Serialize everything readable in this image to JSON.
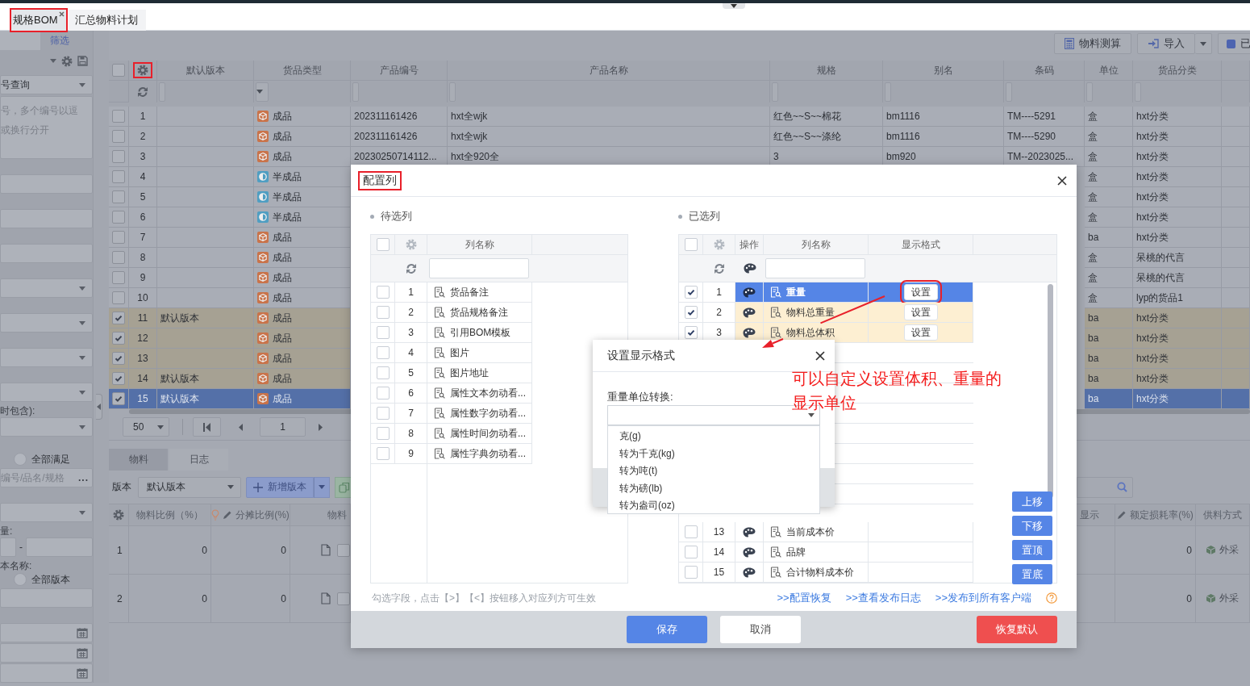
{
  "tabs": [
    {
      "label": "规格BOM",
      "selected": true,
      "closable": true,
      "highlighted": true
    },
    {
      "label": "汇总物料计划",
      "selected": false,
      "closable": false,
      "highlighted": false
    }
  ],
  "filter_panel": {
    "title": "筛选",
    "fields": [
      {
        "kind": "select",
        "value": "号查询"
      },
      {
        "kind": "textarea",
        "placeholder": "号，多个编号以逗或换行分开"
      },
      {
        "kind": "input"
      },
      {
        "kind": "input"
      },
      {
        "kind": "input"
      },
      {
        "kind": "select"
      },
      {
        "kind": "select"
      },
      {
        "kind": "select"
      },
      {
        "kind": "select"
      },
      {
        "kind": "select",
        "label": "时包含):"
      },
      {
        "kind": "radio",
        "option": "全部满足",
        "selected": false
      },
      {
        "kind": "picker",
        "placeholder": "编号/品名/规格",
        "button": "..."
      },
      {
        "kind": "select"
      },
      {
        "kind": "range",
        "label": "量:",
        "separator": "-"
      },
      {
        "kind": "radio",
        "label": "本名称:",
        "option": "全部版本",
        "selected": false
      },
      {
        "kind": "input"
      },
      {
        "kind": "date"
      },
      {
        "kind": "date"
      },
      {
        "kind": "date"
      }
    ]
  },
  "toolbar": [
    {
      "kind": "calc",
      "label": "物料测算",
      "dropdown": false
    },
    {
      "kind": "import",
      "label": "导入",
      "dropdown": true
    },
    {
      "kind": "status",
      "label": "已",
      "dropdown": false
    }
  ],
  "grid": {
    "settings_highlighted": true,
    "all_checked": false,
    "columns": [
      {
        "label": "默认版本",
        "kind": "input"
      },
      {
        "label": "货品类型",
        "kind": "select"
      },
      {
        "label": "产品编号",
        "kind": "input"
      },
      {
        "label": "产品名称",
        "kind": "input"
      },
      {
        "label": "规格",
        "kind": "input"
      },
      {
        "label": "别名",
        "kind": "input"
      },
      {
        "label": "条码",
        "kind": "input"
      },
      {
        "label": "单位",
        "kind": "input"
      },
      {
        "label": "货品分类",
        "kind": "input"
      }
    ],
    "rows": [
      {
        "number": "1",
        "checked": false,
        "selected": false,
        "type": {
          "kind": "finished",
          "label": "成品"
        },
        "code": "202311161426",
        "name": "hxt全wjk",
        "spec": "红色~~S~~棉花",
        "alias": "bm1116",
        "barcode": "TM----5291",
        "unit": "盒",
        "category": "hxt分类"
      },
      {
        "number": "2",
        "checked": false,
        "selected": false,
        "type": {
          "kind": "finished",
          "label": "成品"
        },
        "code": "202311161426",
        "name": "hxt全wjk",
        "spec": "红色~~S~~涤纶",
        "alias": "bm1116",
        "barcode": "TM----5290",
        "unit": "盒",
        "category": "hxt分类"
      },
      {
        "number": "3",
        "checked": false,
        "selected": false,
        "type": {
          "kind": "finished",
          "label": "成品"
        },
        "code": "20230250714112...",
        "name": "hxt全920全",
        "spec": "3",
        "alias": "bm920",
        "barcode": "TM--2023025...",
        "unit": "盒",
        "category": "hxt分类"
      },
      {
        "number": "4",
        "checked": false,
        "selected": false,
        "type": {
          "kind": "semi",
          "label": "半成品"
        },
        "unit": "盒",
        "category": "hxt分类"
      },
      {
        "number": "5",
        "checked": false,
        "selected": false,
        "type": {
          "kind": "semi",
          "label": "半成品"
        },
        "unit": "盒",
        "category": "hxt分类"
      },
      {
        "number": "6",
        "checked": false,
        "selected": false,
        "type": {
          "kind": "semi",
          "label": "半成品"
        },
        "unit": "盒",
        "category": "hxt分类"
      },
      {
        "number": "7",
        "checked": false,
        "selected": false,
        "type": {
          "kind": "finished",
          "label": "成品"
        },
        "unit": "ba",
        "category": "hxt分类"
      },
      {
        "number": "8",
        "checked": false,
        "selected": false,
        "type": {
          "kind": "finished",
          "label": "成品"
        },
        "unit": "盒",
        "category": "呆桃的代言"
      },
      {
        "number": "9",
        "checked": false,
        "selected": false,
        "type": {
          "kind": "finished",
          "label": "成品"
        },
        "unit": "盒",
        "category": "呆桃的代言"
      },
      {
        "number": "10",
        "checked": false,
        "selected": false,
        "type": {
          "kind": "finished",
          "label": "成品"
        },
        "unit": "盒",
        "category": "lyp的货品1"
      },
      {
        "number": "11",
        "checked": true,
        "selected": false,
        "version": "默认版本",
        "type": {
          "kind": "finished",
          "label": "成品"
        },
        "unit": "ba",
        "category": "hxt分类"
      },
      {
        "number": "12",
        "checked": true,
        "selected": false,
        "type": {
          "kind": "finished",
          "label": "成品"
        },
        "unit": "ba",
        "category": "hxt分类"
      },
      {
        "number": "13",
        "checked": true,
        "selected": false,
        "type": {
          "kind": "finished",
          "label": "成品"
        },
        "unit": "ba",
        "category": "hxt分类"
      },
      {
        "number": "14",
        "checked": true,
        "selected": false,
        "version": "默认版本",
        "type": {
          "kind": "finished",
          "label": "成品"
        },
        "unit": "ba",
        "category": "hxt分类"
      },
      {
        "number": "15",
        "checked": true,
        "selected": true,
        "version": "默认版本",
        "type": {
          "kind": "finished",
          "label": "成品"
        },
        "unit": "ba",
        "category": "hxt分类"
      }
    ]
  },
  "pager": {
    "page_size": "50",
    "page": "1"
  },
  "bottom": {
    "tabs": [
      {
        "label": "物料",
        "selected": true
      },
      {
        "label": "日志",
        "selected": false
      }
    ],
    "version_label": "版本",
    "version": "默认版本",
    "add_button": "新增版本",
    "columns_left": [
      {
        "label": "物料比例（%）",
        "kind": "plain",
        "hint": false
      },
      {
        "label": "分摊比例(%)",
        "kind": "editable",
        "hint": true
      },
      {
        "label": "物料",
        "kind": "plain",
        "hint": false
      }
    ],
    "columns_right": [
      {
        "label": "显示",
        "kind": "plain",
        "hint": false
      },
      {
        "label": "额定损耗率(%)",
        "kind": "editable",
        "hint": false
      },
      {
        "label": "供料方式",
        "kind": "plain",
        "hint": false
      }
    ],
    "rows": [
      {
        "number": "1",
        "ratio": "0",
        "share": "0",
        "checked": false,
        "loss": "0",
        "supply": "外采"
      },
      {
        "number": "2",
        "ratio": "0",
        "share": "0",
        "checked": false,
        "loss": "0",
        "supply": "外采"
      }
    ]
  },
  "modal": {
    "title": "配置列",
    "title_highlighted": true,
    "left": {
      "title": "待选列",
      "column": "列名称",
      "all_checked": false,
      "rows": [
        {
          "number": "1",
          "name": "货品备注",
          "checked": false
        },
        {
          "number": "2",
          "name": "货品规格备注",
          "checked": false
        },
        {
          "number": "3",
          "name": "引用BOM模板",
          "checked": false
        },
        {
          "number": "4",
          "name": "图片",
          "checked": false
        },
        {
          "number": "5",
          "name": "图片地址",
          "checked": false
        },
        {
          "number": "6",
          "name": "属性文本勿动看...",
          "checked": false
        },
        {
          "number": "7",
          "name": "属性数字勿动看...",
          "checked": false
        },
        {
          "number": "8",
          "name": "属性时间勿动看...",
          "checked": false
        },
        {
          "number": "9",
          "name": "属性字典勿动看...",
          "checked": false
        }
      ]
    },
    "right": {
      "title": "已选列",
      "columns": [
        "操作",
        "列名称",
        "显示格式"
      ],
      "all_checked": false,
      "top_rows": [
        {
          "number": "1",
          "name": "重量",
          "checked": true,
          "selected": true,
          "action": "设置",
          "highlighted": true
        },
        {
          "number": "2",
          "name": "物料总重量",
          "checked": true,
          "selected": false,
          "action": "设置",
          "highlighted": false
        },
        {
          "number": "3",
          "name": "物料总体积",
          "checked": true,
          "selected": false,
          "action": "设置",
          "highlighted": false
        }
      ],
      "bottom_rows": [
        {
          "number": "13",
          "name": "当前成本价",
          "checked": false,
          "selected": false
        },
        {
          "number": "14",
          "name": "品牌",
          "checked": false,
          "selected": false
        },
        {
          "number": "15",
          "name": "合计物料成本价",
          "checked": false,
          "selected": false
        }
      ]
    },
    "move_buttons": [
      "上移",
      "下移",
      "置顶",
      "置底"
    ],
    "hint": "勾选字段，点击【>】【<】按钮移入对应列方可生效",
    "links": [
      ">>配置恢复",
      ">>查看发布日志",
      ">>发布到所有客户端"
    ],
    "buttons": [
      {
        "label": "保存",
        "kind": "primary"
      },
      {
        "label": "取消",
        "kind": "default"
      },
      {
        "label": "恢复默认",
        "kind": "danger"
      }
    ]
  },
  "popup": {
    "title": "设置显示格式",
    "label": "重量单位转换:",
    "options": [
      "克(g)",
      "转为千克(kg)",
      "转为吨(t)",
      "转为磅(lb)",
      "转为盎司(oz)"
    ]
  },
  "annotation": {
    "text": "可以自定义设置体积、重量的显示单位"
  }
}
